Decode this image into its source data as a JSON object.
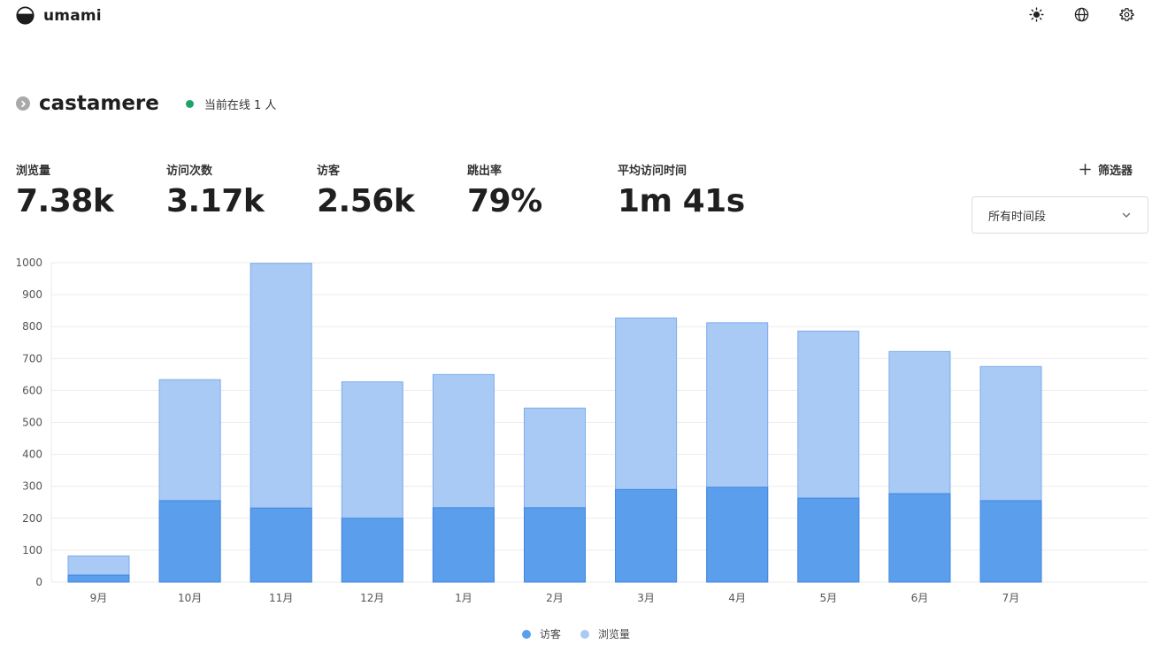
{
  "app": {
    "name": "umami"
  },
  "header": {
    "icons": [
      "sun-icon",
      "globe-icon",
      "gear-icon"
    ]
  },
  "site": {
    "name": "castamere",
    "online_text": "当前在线 1 人",
    "online_color": "#1aa36a"
  },
  "metrics": [
    {
      "label": "浏览量",
      "value": "7.38k"
    },
    {
      "label": "访问次数",
      "value": "3.17k"
    },
    {
      "label": "访客",
      "value": "2.56k"
    },
    {
      "label": "跳出率",
      "value": "79%"
    },
    {
      "label": "平均访问时间",
      "value": "1m 41s"
    }
  ],
  "filter": {
    "label": "筛选器"
  },
  "date_range": {
    "selected": "所有时间段"
  },
  "colors": {
    "visitors": "#5b9eec",
    "pageviews": "#a9caf5",
    "visitors_stroke": "#3f86e0",
    "pageviews_stroke": "#7cabea"
  },
  "chart_data": {
    "type": "bar",
    "stacked_overlay": true,
    "categories": [
      "9月",
      "10月",
      "11月",
      "12月",
      "1月",
      "2月",
      "3月",
      "4月",
      "5月",
      "6月",
      "7月"
    ],
    "series": [
      {
        "name": "访客",
        "values": [
          22,
          255,
          232,
          200,
          233,
          233,
          290,
          297,
          263,
          277,
          255
        ]
      },
      {
        "name": "浏览量",
        "values": [
          82,
          634,
          998,
          627,
          650,
          545,
          827,
          812,
          786,
          722,
          675
        ]
      }
    ],
    "ylim": [
      0,
      1000
    ],
    "yticks": [
      0,
      100,
      200,
      300,
      400,
      500,
      600,
      700,
      800,
      900,
      1000
    ],
    "grid": true,
    "legend": "bottom-center"
  }
}
